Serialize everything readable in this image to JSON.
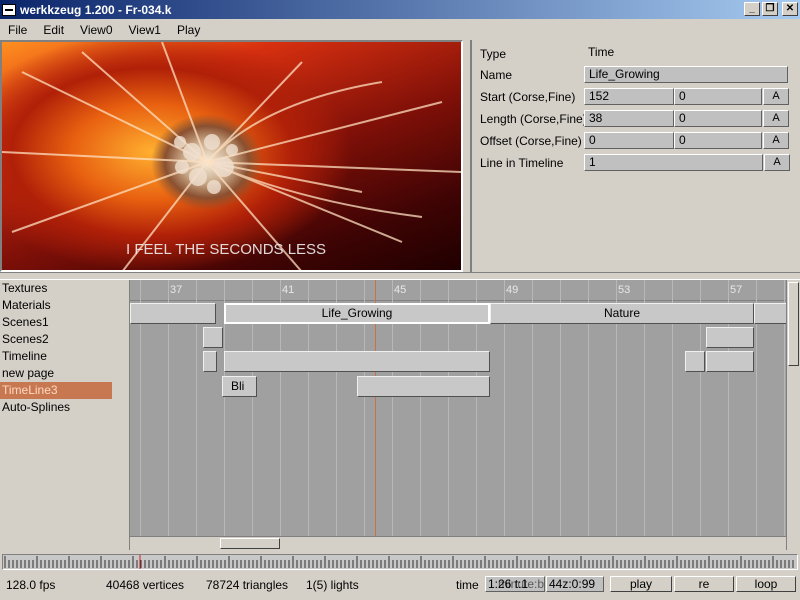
{
  "window": {
    "title": "werkkzeug 1.200 - Fr-034.k",
    "controls": [
      "_",
      "❐",
      "✕"
    ]
  },
  "menu": [
    "File",
    "Edit",
    "View0",
    "View1",
    "Play"
  ],
  "preview": {
    "caption": "I FEEL THE SECONDS LESS"
  },
  "properties": {
    "type_label": "Type",
    "type_value": "Time",
    "name_label": "Name",
    "name_value": "Life_Growing",
    "start_label": "Start (Corse,Fine)",
    "start_coarse": "152",
    "start_fine": "0",
    "length_label": "Length (Corse,Fine)",
    "length_coarse": "38",
    "length_fine": "0",
    "offset_label": "Offset (Corse,Fine)",
    "offset_coarse": "0",
    "offset_fine": "0",
    "line_label": "Line in Timeline",
    "line_value": "1",
    "a_button": "A"
  },
  "pages": [
    "Textures",
    "Materials",
    "Scenes1",
    "Scenes2",
    "Timeline",
    "new page",
    "TimeLine3",
    "Auto-Splines"
  ],
  "selected_page": "TimeLine3",
  "ruler_ticks": [
    "37",
    "41",
    "45",
    "49",
    "53",
    "57"
  ],
  "clips": [
    {
      "label": "",
      "row": 0
    },
    {
      "label": "Life_Growing",
      "row": 0
    },
    {
      "label": "Nature",
      "row": 0
    },
    {
      "label": "",
      "row": 0
    },
    {
      "label": "",
      "row": 1
    },
    {
      "label": "",
      "row": 1
    },
    {
      "label": "",
      "row": 2
    },
    {
      "label": "",
      "row": 2
    },
    {
      "label": "",
      "row": 2
    },
    {
      "label": "",
      "row": 2
    },
    {
      "label": "Bli",
      "row": 3
    },
    {
      "label": "",
      "row": 3
    }
  ],
  "status": {
    "fps": "128.0 fps",
    "vertices": "40468 vertices",
    "triangles": "78724 triangles",
    "lights": "1(5) lights",
    "time_label": "time",
    "time_value": "1:26 t:1",
    "beat_value": "44z:0:99",
    "beat_overlay": "minute:bar",
    "play": "play",
    "re": "re",
    "loop": "loop"
  },
  "colors": {
    "title_start": "#0a246a",
    "title_end": "#a6caf0",
    "selected_page": "#c87850",
    "cursor": "#d07040"
  }
}
